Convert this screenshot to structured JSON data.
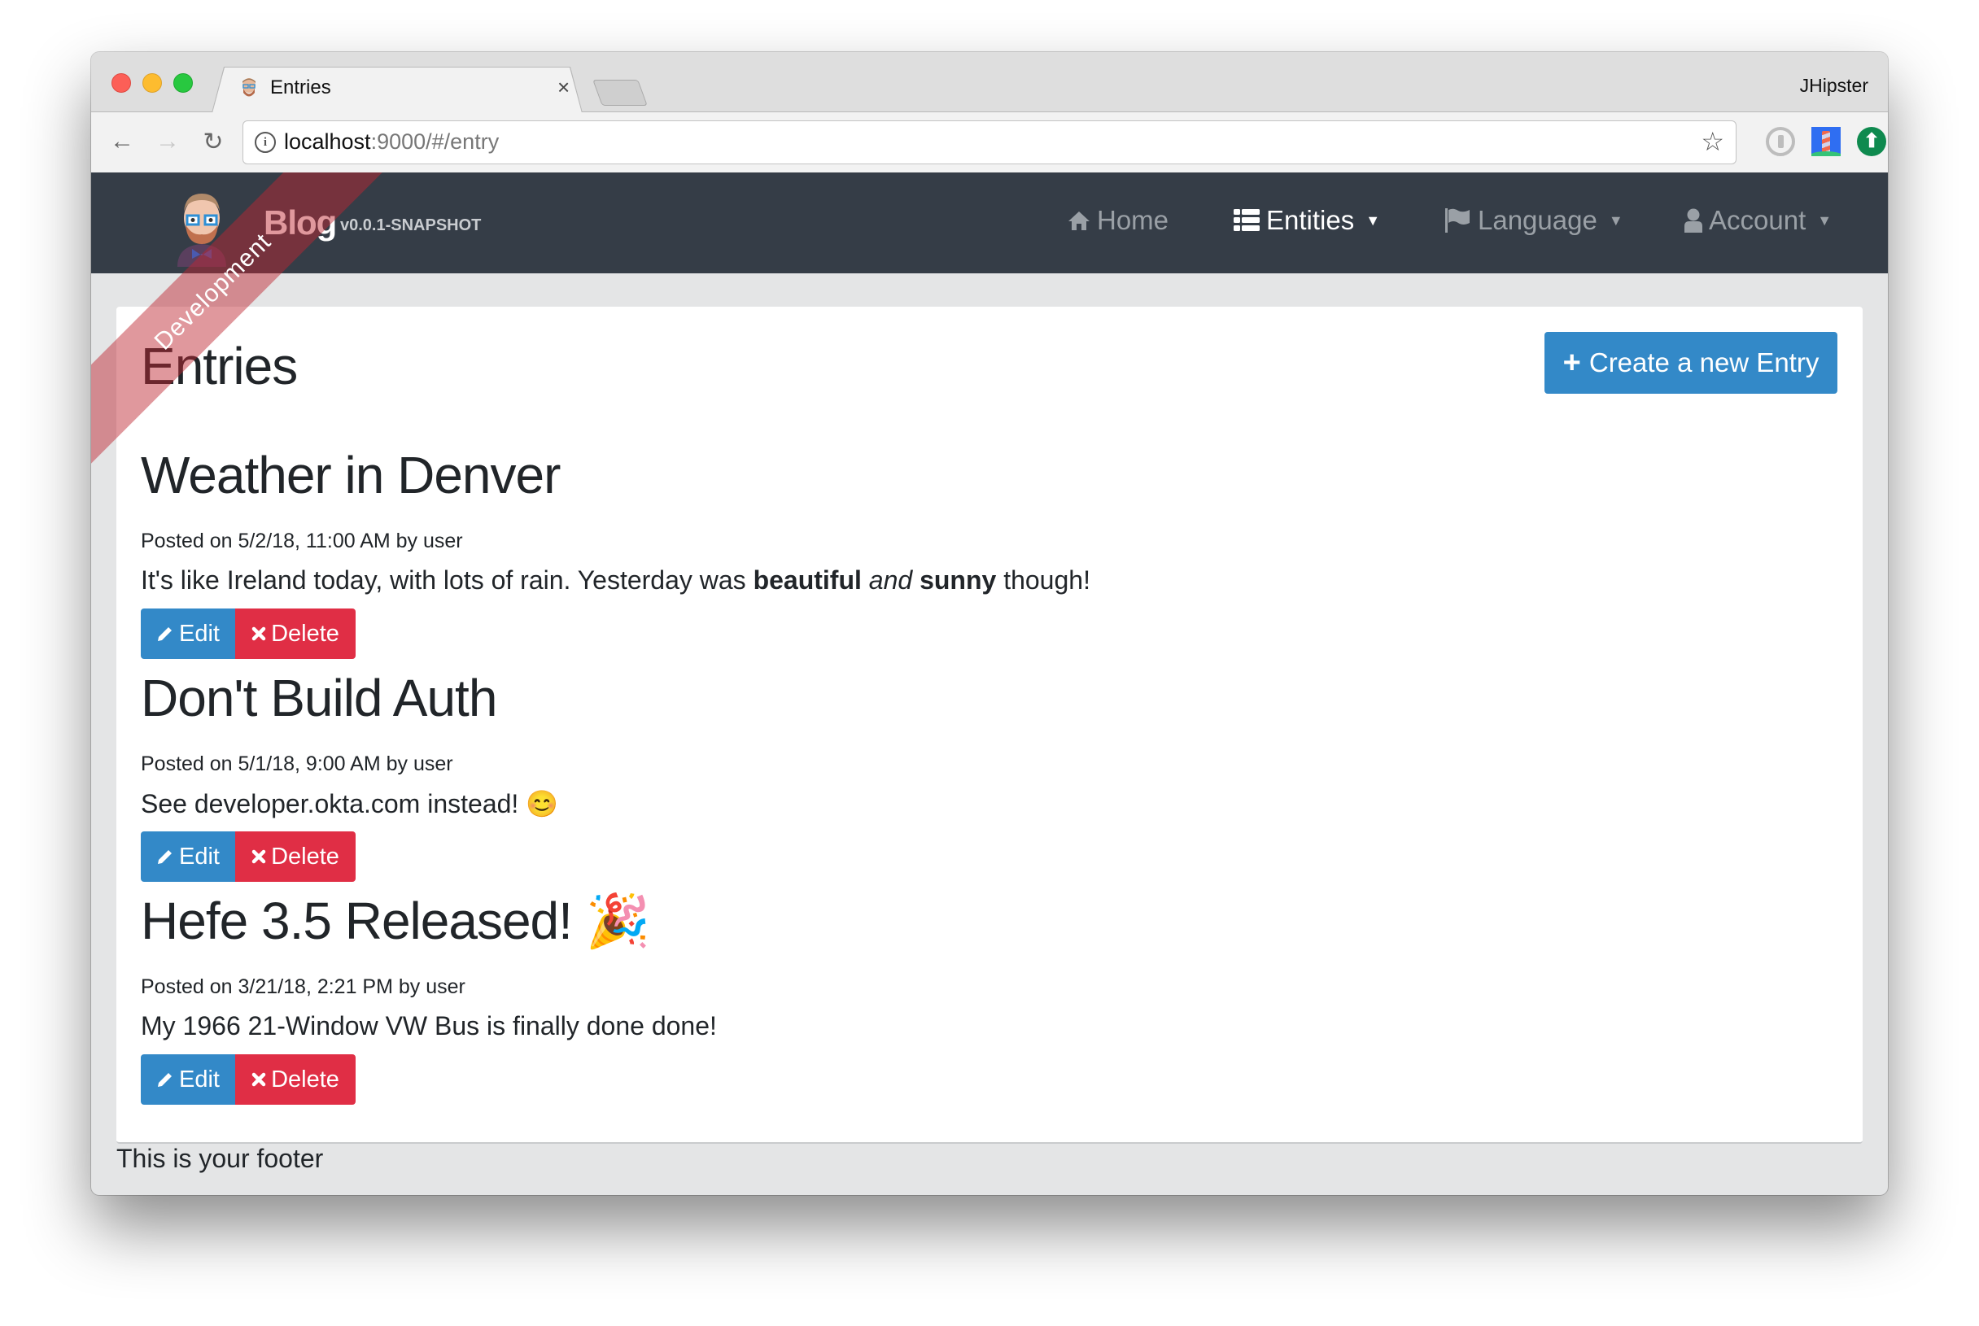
{
  "browser": {
    "tab_title": "Entries",
    "tab_close": "×",
    "profile_name": "JHipster",
    "url_host": "localhost",
    "url_rest": ":9000/#/entry",
    "icons": {
      "back": "←",
      "forward": "→",
      "reload": "↻",
      "info": "i",
      "bookmark": "☆",
      "upload": "⬆"
    }
  },
  "navbar": {
    "brand": "Blog",
    "version": "v0.0.1-SNAPSHOT",
    "items": [
      {
        "label": "Home",
        "icon": "home-icon",
        "active": false
      },
      {
        "label": "Entities",
        "icon": "list-icon",
        "active": true,
        "dropdown": true
      },
      {
        "label": "Language",
        "icon": "flag-icon",
        "active": false,
        "dropdown": true
      },
      {
        "label": "Account",
        "icon": "user-icon",
        "active": false,
        "dropdown": true
      }
    ],
    "caret": "▼"
  },
  "ribbon": "Development",
  "page": {
    "title": "Entries",
    "create_button": "Create a new Entry",
    "create_icon": "+"
  },
  "entries": [
    {
      "title": "Weather in Denver",
      "meta": "Posted on 5/2/18, 11:00 AM by user",
      "body_parts": [
        "It's like Ireland today, with lots of rain. Yesterday was ",
        "beautiful",
        " ",
        "and",
        " ",
        "sunny",
        " though!"
      ],
      "edit": "Edit",
      "delete": "Delete"
    },
    {
      "title": "Don't Build Auth",
      "meta": "Posted on 5/1/18, 9:00 AM by user",
      "body": "See developer.okta.com instead! 😊",
      "edit": "Edit",
      "delete": "Delete"
    },
    {
      "title": "Hefe 3.5 Released! 🎉",
      "meta": "Posted on 3/21/18, 2:21 PM by user",
      "body": "My 1966 21-Window VW Bus is finally done done!",
      "edit": "Edit",
      "delete": "Delete"
    }
  ],
  "footer": "This is your footer",
  "colors": {
    "navbar": "#353d47",
    "primary": "#3389c8",
    "danger": "#e02e45",
    "content_bg": "#e4e5e6",
    "ribbon": "#be2832"
  }
}
